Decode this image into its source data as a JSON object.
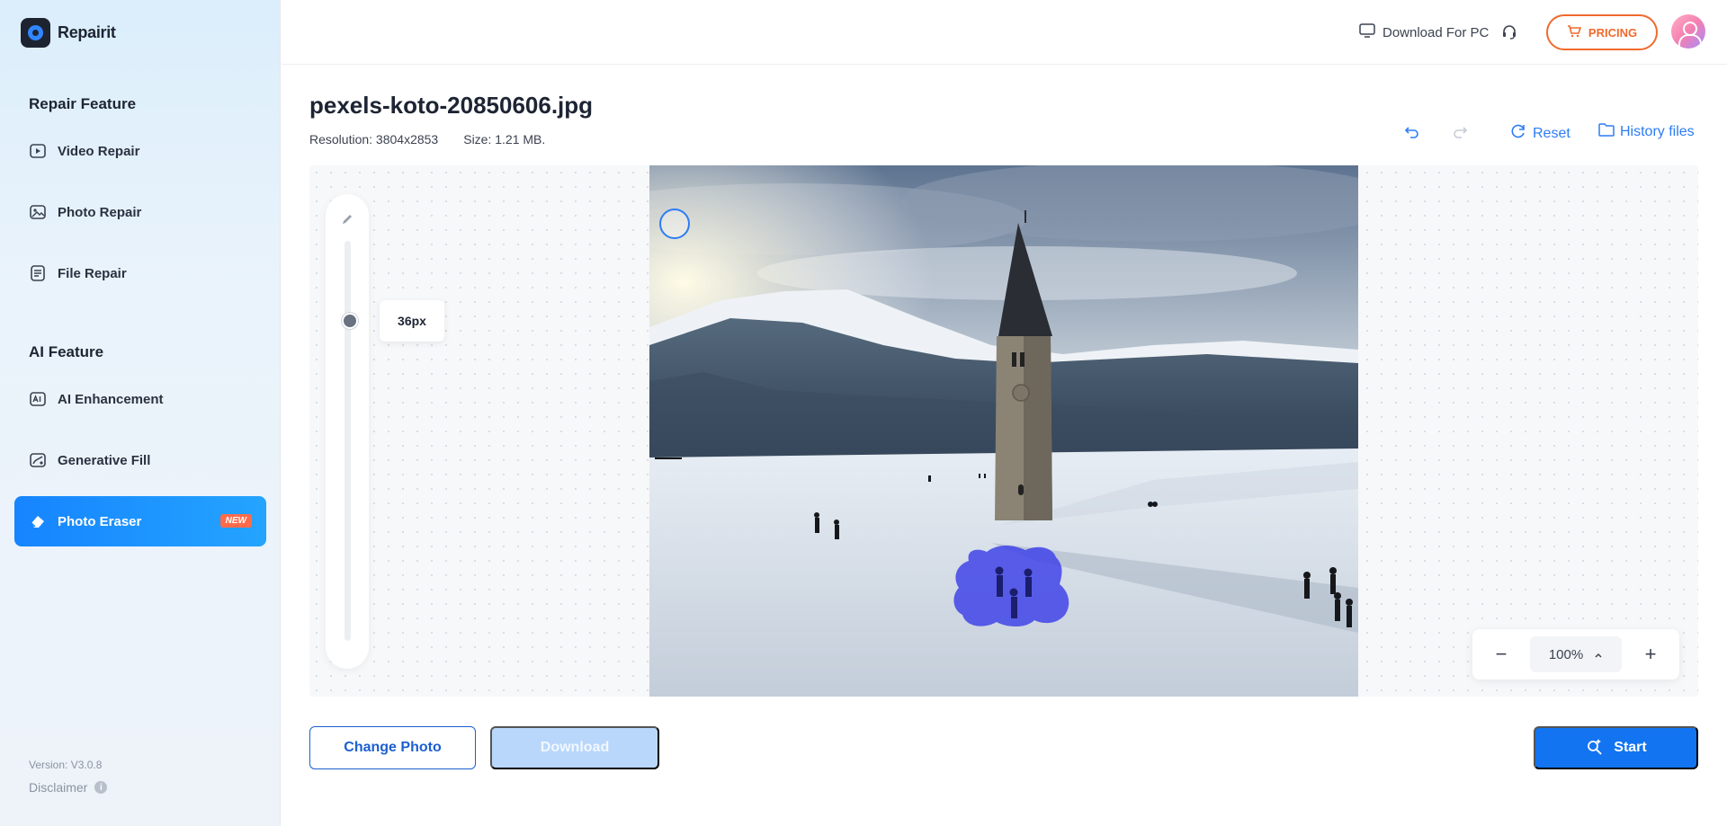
{
  "app": {
    "name": "Repairit",
    "version": "Version: V3.0.8",
    "disclaimer": "Disclaimer"
  },
  "sidebar": {
    "repair_title": "Repair Feature",
    "repair_items": [
      {
        "label": "Video Repair",
        "icon": "video-icon"
      },
      {
        "label": "Photo Repair",
        "icon": "photo-icon"
      },
      {
        "label": "File Repair",
        "icon": "file-icon"
      }
    ],
    "ai_title": "AI Feature",
    "ai_items": [
      {
        "label": "AI Enhancement",
        "icon": "ai-icon"
      },
      {
        "label": "Generative Fill",
        "icon": "fill-icon"
      },
      {
        "label": "Photo Eraser",
        "icon": "eraser-icon",
        "badge": "NEW",
        "active": true
      }
    ]
  },
  "header": {
    "download_pc": "Download For PC",
    "pricing": "PRICING"
  },
  "file": {
    "name": "pexels-koto-20850606.jpg",
    "resolution": "Resolution: 3804x2853",
    "size": "Size: 1.21 MB."
  },
  "toolbar": {
    "reset": "Reset",
    "history": "History files"
  },
  "brush": {
    "size_label": "36px",
    "level": 0.2
  },
  "zoom": {
    "value": "100%"
  },
  "actions": {
    "change_photo": "Change Photo",
    "download": "Download",
    "start": "Start"
  },
  "colors": {
    "accent": "#1274f1",
    "pricing": "#f06a2c",
    "mask": "#3a3ee8"
  }
}
